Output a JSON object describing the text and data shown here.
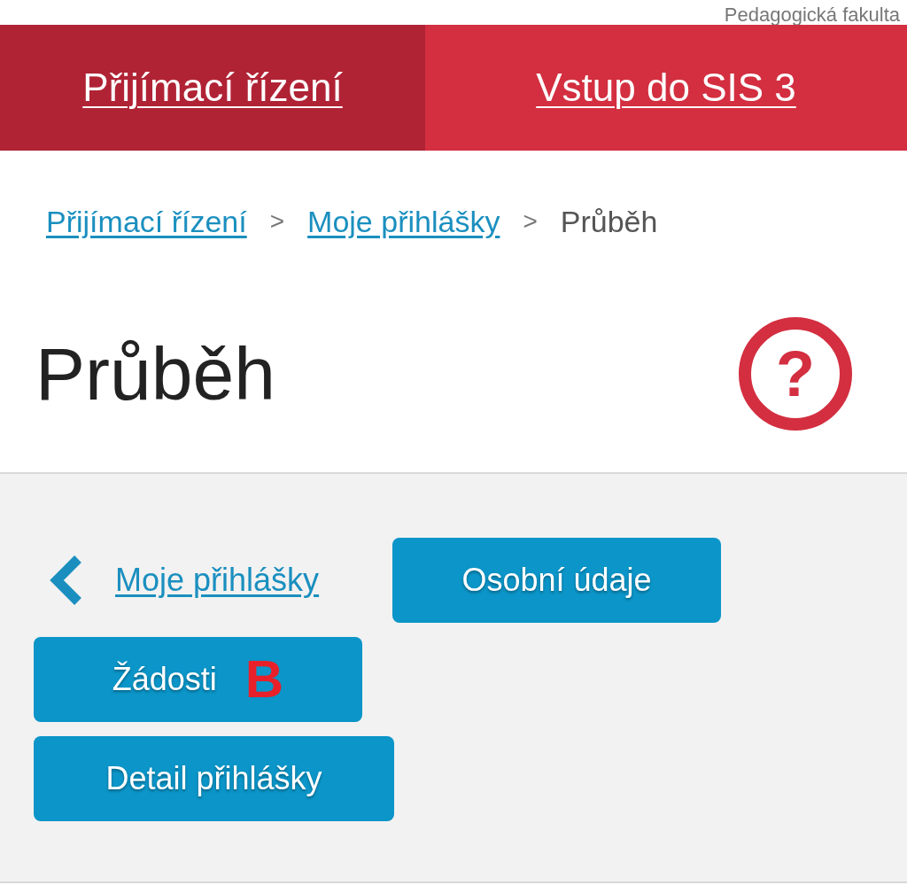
{
  "header": {
    "faculty": "Pedagogická fakulta"
  },
  "nav": [
    {
      "label": "Přijímací řízení",
      "selected": true
    },
    {
      "label": "Vstup do SIS 3",
      "selected": false
    }
  ],
  "breadcrumb": {
    "links": [
      "Přijímací řízení",
      "Moje přihlášky"
    ],
    "separator": ">",
    "current": "Průběh"
  },
  "title": "Průběh",
  "help": {
    "symbol": "?"
  },
  "back_link": "Moje přihlášky",
  "buttons": [
    {
      "label": "Osobní údaje"
    },
    {
      "label": "Žádosti",
      "marker": "B"
    },
    {
      "label": "Detail přihlášky"
    }
  ]
}
